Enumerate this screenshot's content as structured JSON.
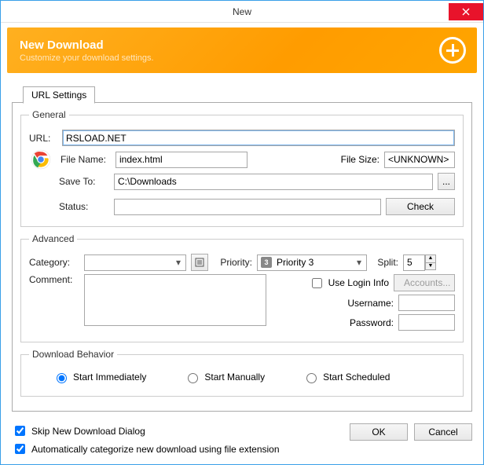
{
  "window": {
    "title": "New"
  },
  "banner": {
    "title": "New Download",
    "subtitle": "Customize your download settings."
  },
  "tab": {
    "url_settings": "URL Settings"
  },
  "general": {
    "legend": "General",
    "url_label": "URL:",
    "url_value": "RSLOAD.NET",
    "filename_label": "File Name:",
    "filename_value": "index.html",
    "filesize_label": "File Size:",
    "filesize_value": "<UNKNOWN>",
    "saveto_label": "Save To:",
    "saveto_value": "C:\\Downloads",
    "status_label": "Status:",
    "status_value": "",
    "check_button": "Check",
    "browse_button": "..."
  },
  "advanced": {
    "legend": "Advanced",
    "category_label": "Category:",
    "category_value": "",
    "priority_label": "Priority:",
    "priority_value": "Priority 3",
    "priority_badge": "3",
    "split_label": "Split:",
    "split_value": "5",
    "comment_label": "Comment:",
    "comment_value": "",
    "use_login": "Use Login Info",
    "accounts_button": "Accounts...",
    "username_label": "Username:",
    "username_value": "",
    "password_label": "Password:",
    "password_value": ""
  },
  "behavior": {
    "legend": "Download Behavior",
    "start_immediately": "Start Immediately",
    "start_manually": "Start Manually",
    "start_scheduled": "Start Scheduled"
  },
  "footer": {
    "skip_dialog": "Skip New Download Dialog",
    "auto_categorize": "Automatically categorize new download using file extension",
    "ok": "OK",
    "cancel": "Cancel"
  }
}
